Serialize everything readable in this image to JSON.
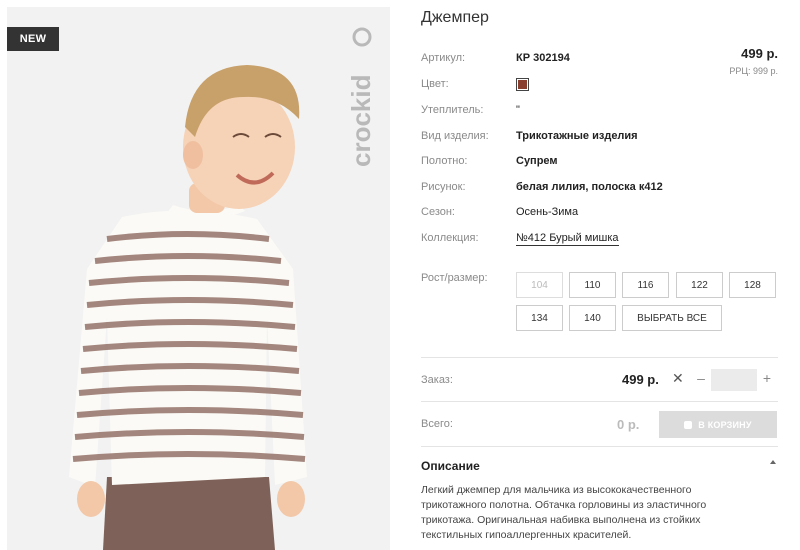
{
  "product": {
    "badge": "NEW",
    "brand": "crockid",
    "title": "Джемпер",
    "price": "499 р.",
    "rrp": "РРЦ: 999 р."
  },
  "attributes": {
    "article": {
      "label": "Артикул:",
      "value": "КР 302194"
    },
    "color": {
      "label": "Цвет:",
      "swatch": "#8a3f2e"
    },
    "insulation": {
      "label": "Утеплитель:",
      "value": "\""
    },
    "type": {
      "label": "Вид изделия:",
      "value": "Трикотажные изделия"
    },
    "fabric": {
      "label": "Полотно:",
      "value": "Супрем"
    },
    "print": {
      "label": "Рисунок:",
      "value": "белая лилия, полоска к412"
    },
    "season": {
      "label": "Сезон:",
      "value": "Осень-Зима"
    },
    "collection": {
      "label": "Коллекция:",
      "value": "№412 Бурый мишка"
    }
  },
  "sizes": {
    "label": "Рост/размер:",
    "options": [
      "104",
      "110",
      "116",
      "122",
      "128",
      "134",
      "140"
    ],
    "select_all": "ВЫБРАТЬ ВСЕ"
  },
  "order": {
    "label": "Заказ:",
    "price": "499 р.",
    "qty": "",
    "minus": "–",
    "plus": "+"
  },
  "total": {
    "label": "Всего:",
    "sum": "0 р.",
    "cart_button": "В КОРЗИНУ"
  },
  "description": {
    "heading": "Описание",
    "lines": [
      "Легкий джемпер для мальчика из высококачественного",
      "трикотажного полотна. Обтачка горловины из эластичного",
      "трикотажа. Оригинальная набивка выполнена из стойких",
      "текстильных гипоаллергенных красителей."
    ]
  }
}
